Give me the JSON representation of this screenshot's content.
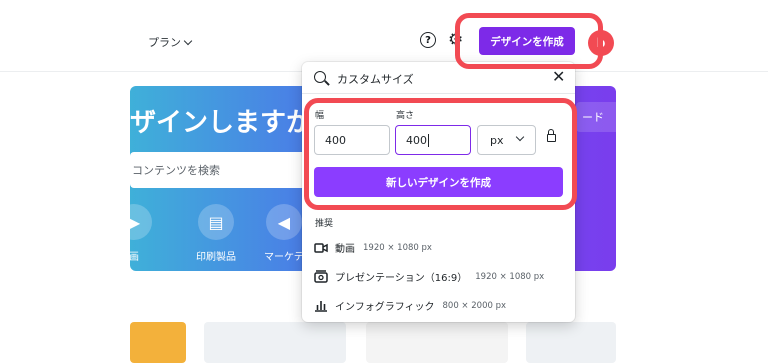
{
  "nav": {
    "plan_label": "プラン",
    "help_icon": "?",
    "create_button_label": "デザインを作成",
    "avatar_letter": "b"
  },
  "hero": {
    "title": "ザインしますか？",
    "search_placeholder": "コンテンツを検索",
    "right_button_label": "ード",
    "categories": [
      {
        "label": "画",
        "icon": "video-camera-icon"
      },
      {
        "label": "印刷製品",
        "icon": "printer-icon"
      },
      {
        "label": "マーケテ",
        "icon": "megaphone-icon"
      }
    ]
  },
  "panel": {
    "search_value": "カスタムサイズ",
    "width_label": "幅",
    "height_label": "高さ",
    "width_value": "400",
    "height_value": "400",
    "unit_value": "px",
    "create_new_label": "新しいデザインを作成",
    "recommended_title": "推奨",
    "recommended": [
      {
        "name": "動画",
        "size": "1920 × 1080 px",
        "icon": "video-icon"
      },
      {
        "name": "プレゼンテーション（16:9）",
        "size": "1920 × 1080 px",
        "icon": "presentation-icon"
      },
      {
        "name": "インフォグラフィック",
        "size": "800 × 2000 px",
        "icon": "bar-chart-icon"
      }
    ]
  },
  "colors": {
    "brand_purple": "#7d2ae8",
    "button_purple": "#8b3dff",
    "highlight_red": "#f24a53"
  }
}
